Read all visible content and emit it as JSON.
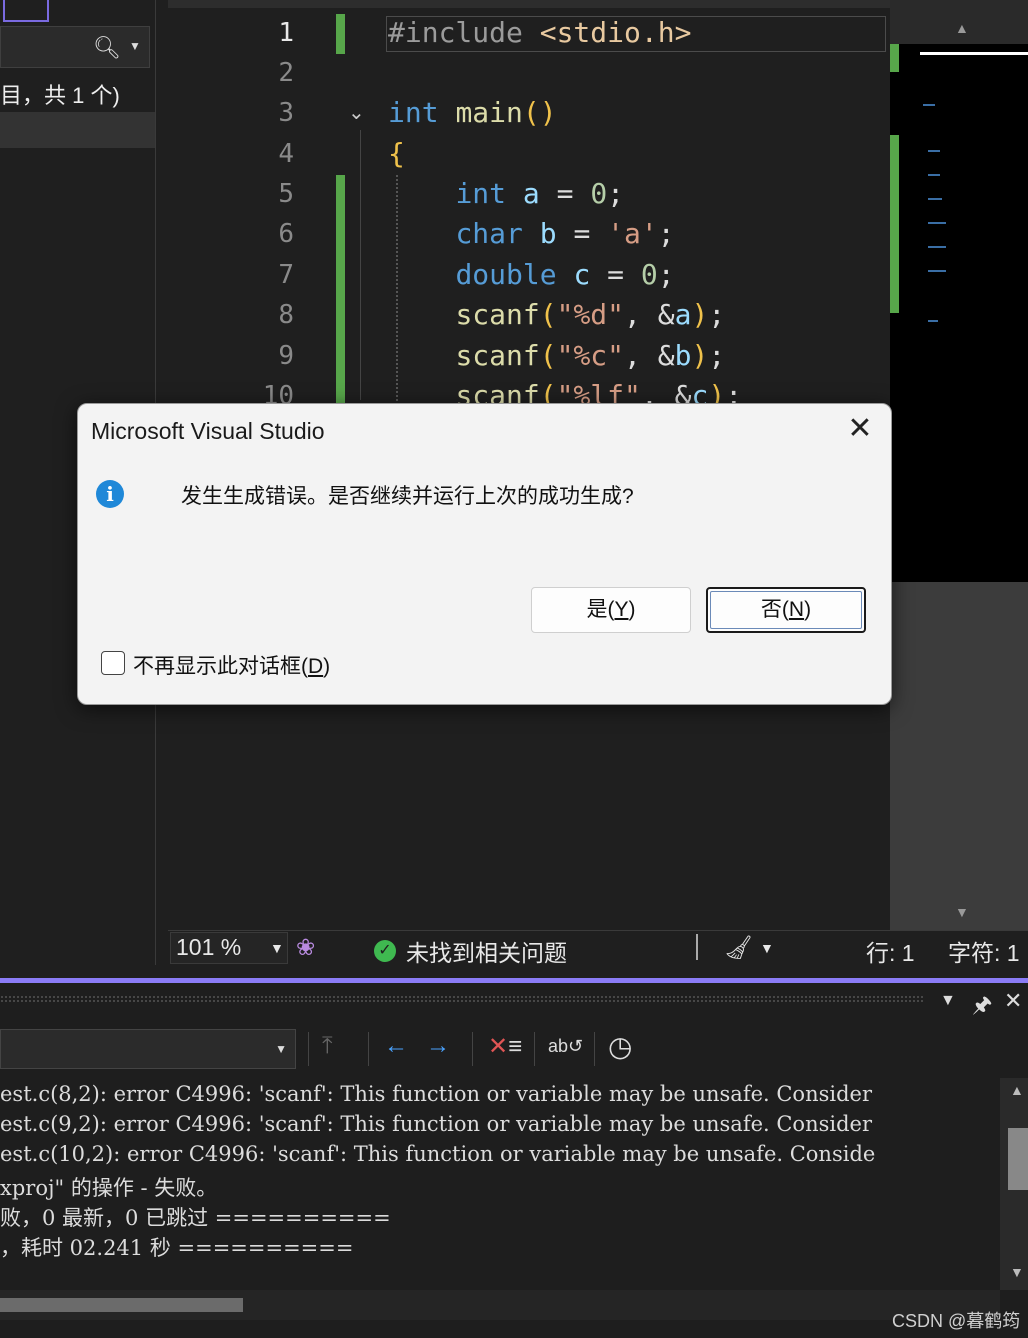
{
  "solution_explorer": {
    "item_count_text": "目，共 1 个)"
  },
  "editor": {
    "lines": [
      {
        "n": "1",
        "text": "#include <stdio.h>"
      },
      {
        "n": "2",
        "text": ""
      },
      {
        "n": "3",
        "text": "int main()"
      },
      {
        "n": "4",
        "text": "{"
      },
      {
        "n": "5",
        "text": "    int a = 0;"
      },
      {
        "n": "6",
        "text": "    char b = 'a';"
      },
      {
        "n": "7",
        "text": "    double c = 0;"
      },
      {
        "n": "8",
        "text": "    scanf(\"%d\", &a);"
      },
      {
        "n": "9",
        "text": "    scanf(\"%c\", &b);"
      },
      {
        "n": "10",
        "text": "    scanf(\"%lf\", &c);"
      }
    ]
  },
  "statusbar": {
    "zoom": "101 %",
    "issues": "未找到相关问题",
    "line": "行: 1",
    "col": "字符: 1"
  },
  "output": {
    "lines": [
      "est.c(8,2): error C4996: 'scanf': This function or variable may be unsafe. Consider",
      "est.c(9,2): error C4996: 'scanf': This function or variable may be unsafe. Consider",
      "est.c(10,2): error C4996: 'scanf': This function or variable may be unsafe. Conside",
      "xproj\" 的操作 - 失败。",
      "败，0 最新，0 已跳过 ==========",
      "，耗时 02.241 秒 =========="
    ]
  },
  "dialog": {
    "title": "Microsoft Visual Studio",
    "message": "发生生成错误。是否继续并运行上次的成功生成?",
    "yes_label": "是(",
    "yes_key": "Y",
    "no_label": "否(",
    "no_key": "N",
    "dont_show_label": "不再显示此对话框(",
    "dont_show_key": "D",
    "paren_close": ")"
  },
  "watermark": "CSDN @暮鹤筠",
  "colors": {
    "accent": "#8b7cf6",
    "git_change": "#57a64a",
    "info": "#1f88d8"
  }
}
